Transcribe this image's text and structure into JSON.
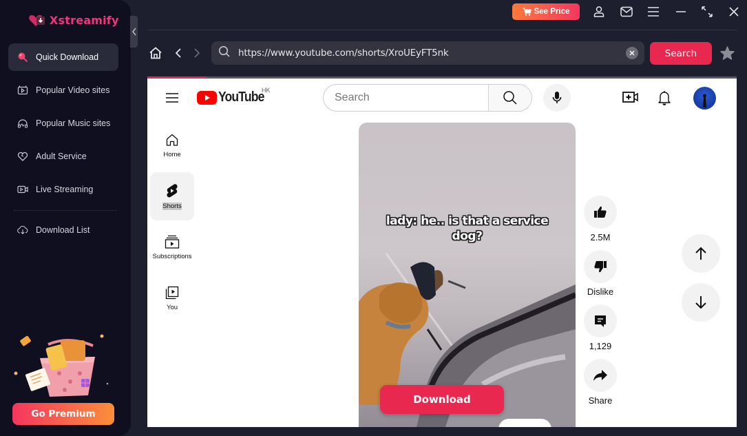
{
  "app": {
    "name": "Xstreamify",
    "brand_color": "#f0367a",
    "accent_color": "#e8284f"
  },
  "sidebar": {
    "items": [
      {
        "label": "Quick Download",
        "icon": "lollipop-search-icon",
        "active": true
      },
      {
        "label": "Popular Video sites",
        "icon": "tv-play-icon",
        "active": false
      },
      {
        "label": "Popular Music sites",
        "icon": "headphones-icon",
        "active": false
      },
      {
        "label": "Adult Service",
        "icon": "heart-icon",
        "active": false
      },
      {
        "label": "Live Streaming",
        "icon": "video-camera-icon",
        "active": false
      }
    ],
    "download_list": {
      "label": "Download List",
      "icon": "cloud-download-icon"
    },
    "premium_button": "Go Premium"
  },
  "titlebar": {
    "see_price": "See Price",
    "icons": [
      "user-icon",
      "mail-icon",
      "menu-icon",
      "minimize-icon",
      "maximize-icon",
      "close-icon"
    ]
  },
  "navbar": {
    "url": "https://www.youtube.com/shorts/XroUEyFT5nk",
    "search_button": "Search"
  },
  "page_load_progress": 0.1,
  "youtube": {
    "region": "HK",
    "logo_text": "YouTube",
    "search_placeholder": "Search",
    "guide": [
      {
        "label": "Home",
        "active": false
      },
      {
        "label": "Shorts",
        "active": true
      },
      {
        "label": "Subscriptions",
        "active": false
      },
      {
        "label": "You",
        "active": false
      }
    ],
    "short": {
      "caption_line1": "lady: he.. is that a service",
      "caption_line2": "dog?",
      "download_button": "Download"
    },
    "actions": {
      "likes": "2.5M",
      "dislike": "Dislike",
      "comments": "1,129",
      "share": "Share"
    }
  }
}
